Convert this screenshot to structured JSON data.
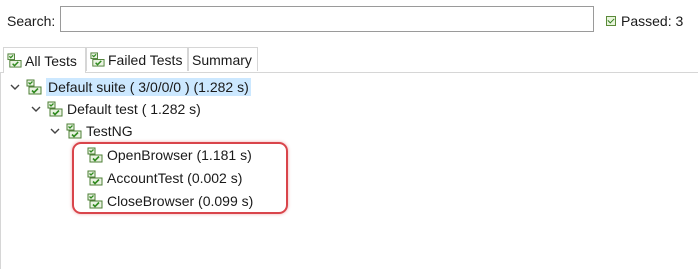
{
  "search": {
    "label": "Search:",
    "value": "",
    "placeholder": ""
  },
  "status": {
    "passed_text": "Passed: 3"
  },
  "tabs": [
    {
      "label": "All Tests",
      "active": true
    },
    {
      "label": "Failed Tests",
      "active": false
    },
    {
      "label": "Summary",
      "active": false
    }
  ],
  "tree": {
    "suite": {
      "label": "Default suite ( 3/0/0/0 ) (1.282 s)"
    },
    "test": {
      "label": "Default test ( 1.282 s)"
    },
    "class": {
      "label": "TestNG"
    },
    "methods": [
      {
        "label": "OpenBrowser  (1.181 s)"
      },
      {
        "label": "AccountTest  (0.002 s)"
      },
      {
        "label": "CloseBrowser  (0.099 s)"
      }
    ]
  },
  "colors": {
    "selection": "#cce8ff",
    "highlight": "#d9454b",
    "pass_green": "#3f8f2a"
  },
  "icons": [
    "passed-check-icon",
    "test-tree-icon",
    "chevron-down-icon",
    "test-node-icon"
  ]
}
